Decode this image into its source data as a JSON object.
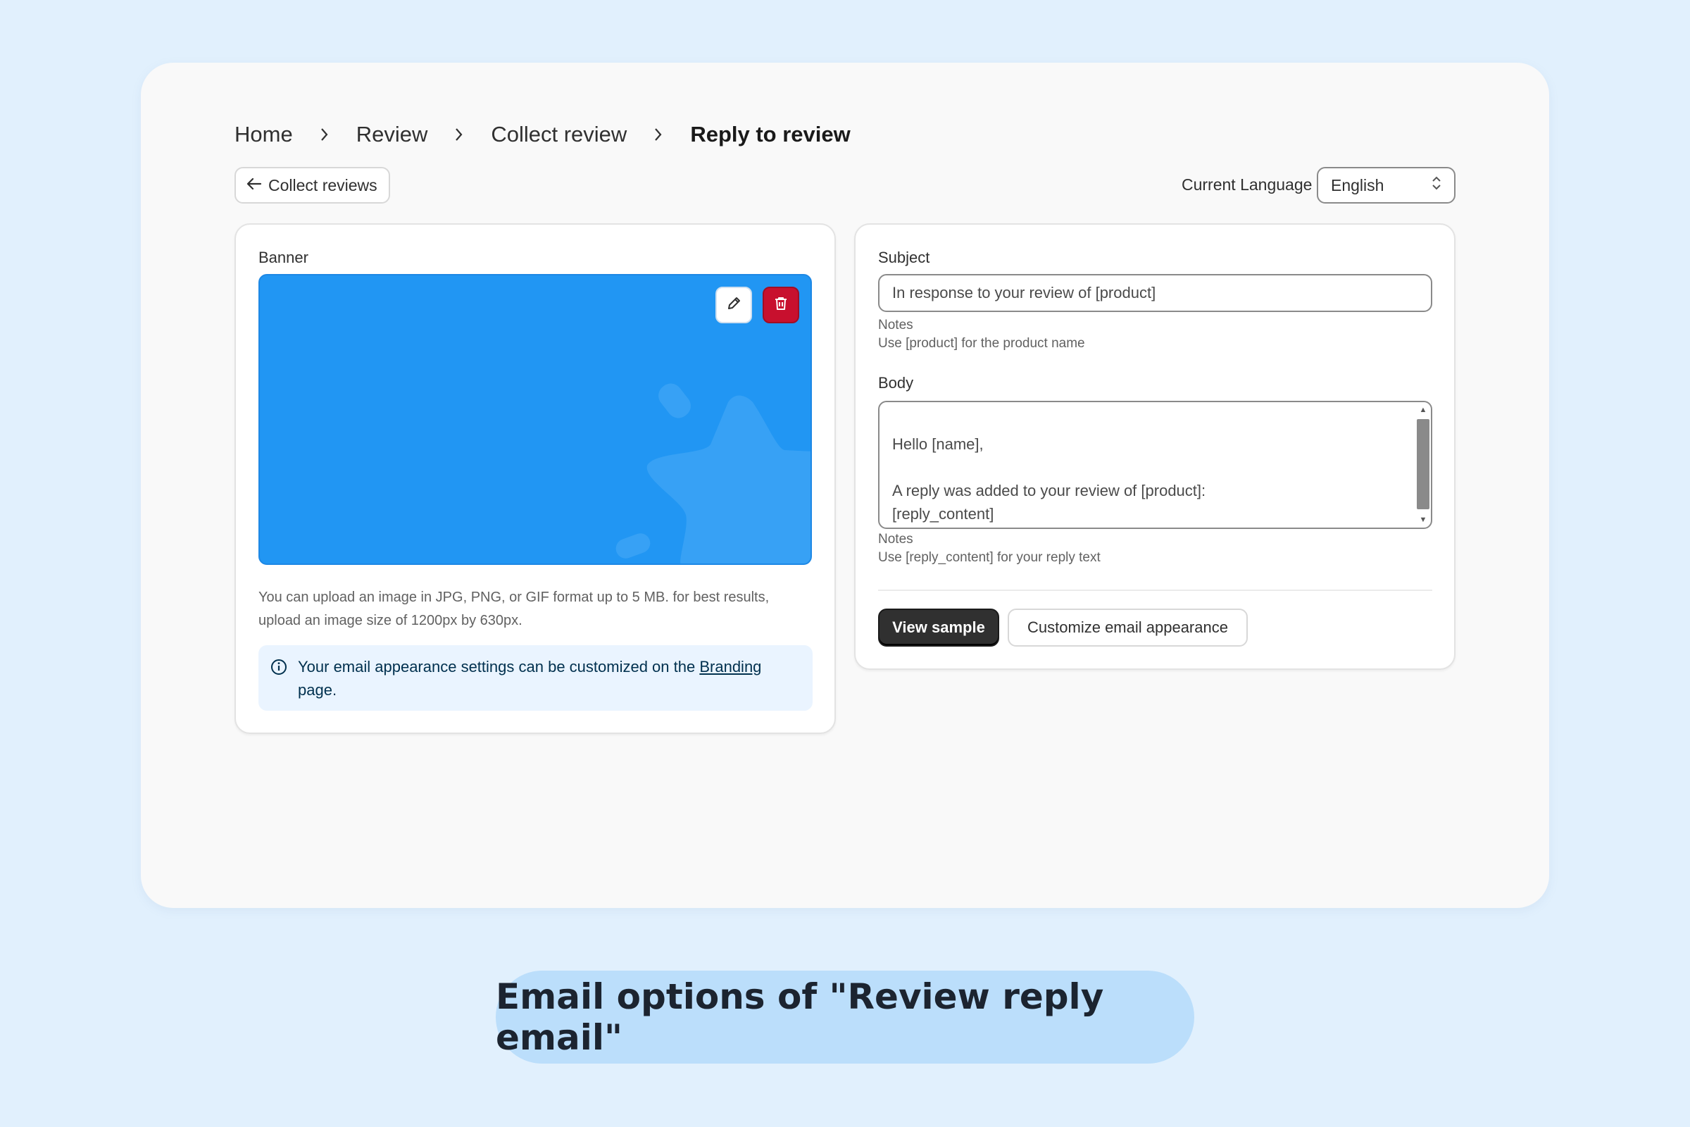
{
  "breadcrumb": {
    "items": [
      "Home",
      "Review",
      "Collect review"
    ],
    "current": "Reply to review"
  },
  "toolbar": {
    "back_label": "Collect reviews",
    "language_label": "Current Language",
    "language_value": "English"
  },
  "banner_panel": {
    "label": "Banner",
    "help_text": "You can upload an image in JPG, PNG, or GIF format up to 5 MB. for best results, upload an image size of 1200px by 630px.",
    "info_text": "Your email appearance settings can be customized on the",
    "info_link": "Branding",
    "info_suffix": "page.",
    "banner_color": "#2196f3",
    "delete_color": "#c8102e"
  },
  "email_panel": {
    "subject_label": "Subject",
    "subject_value": "In response to your review of [product]",
    "subject_notes_title": "Notes",
    "subject_notes": "Use [product] for the product name",
    "body_label": "Body",
    "body_value": "Hello [name],\n\nA reply was added to your review of [product]:\n[reply_content]\nTo respond privately, reply to this email.",
    "body_notes_title": "Notes",
    "body_notes": "Use [reply_content] for your reply text",
    "view_sample": "View sample",
    "customize": "Customize email appearance"
  },
  "caption": "Email options of \"Review reply email\""
}
